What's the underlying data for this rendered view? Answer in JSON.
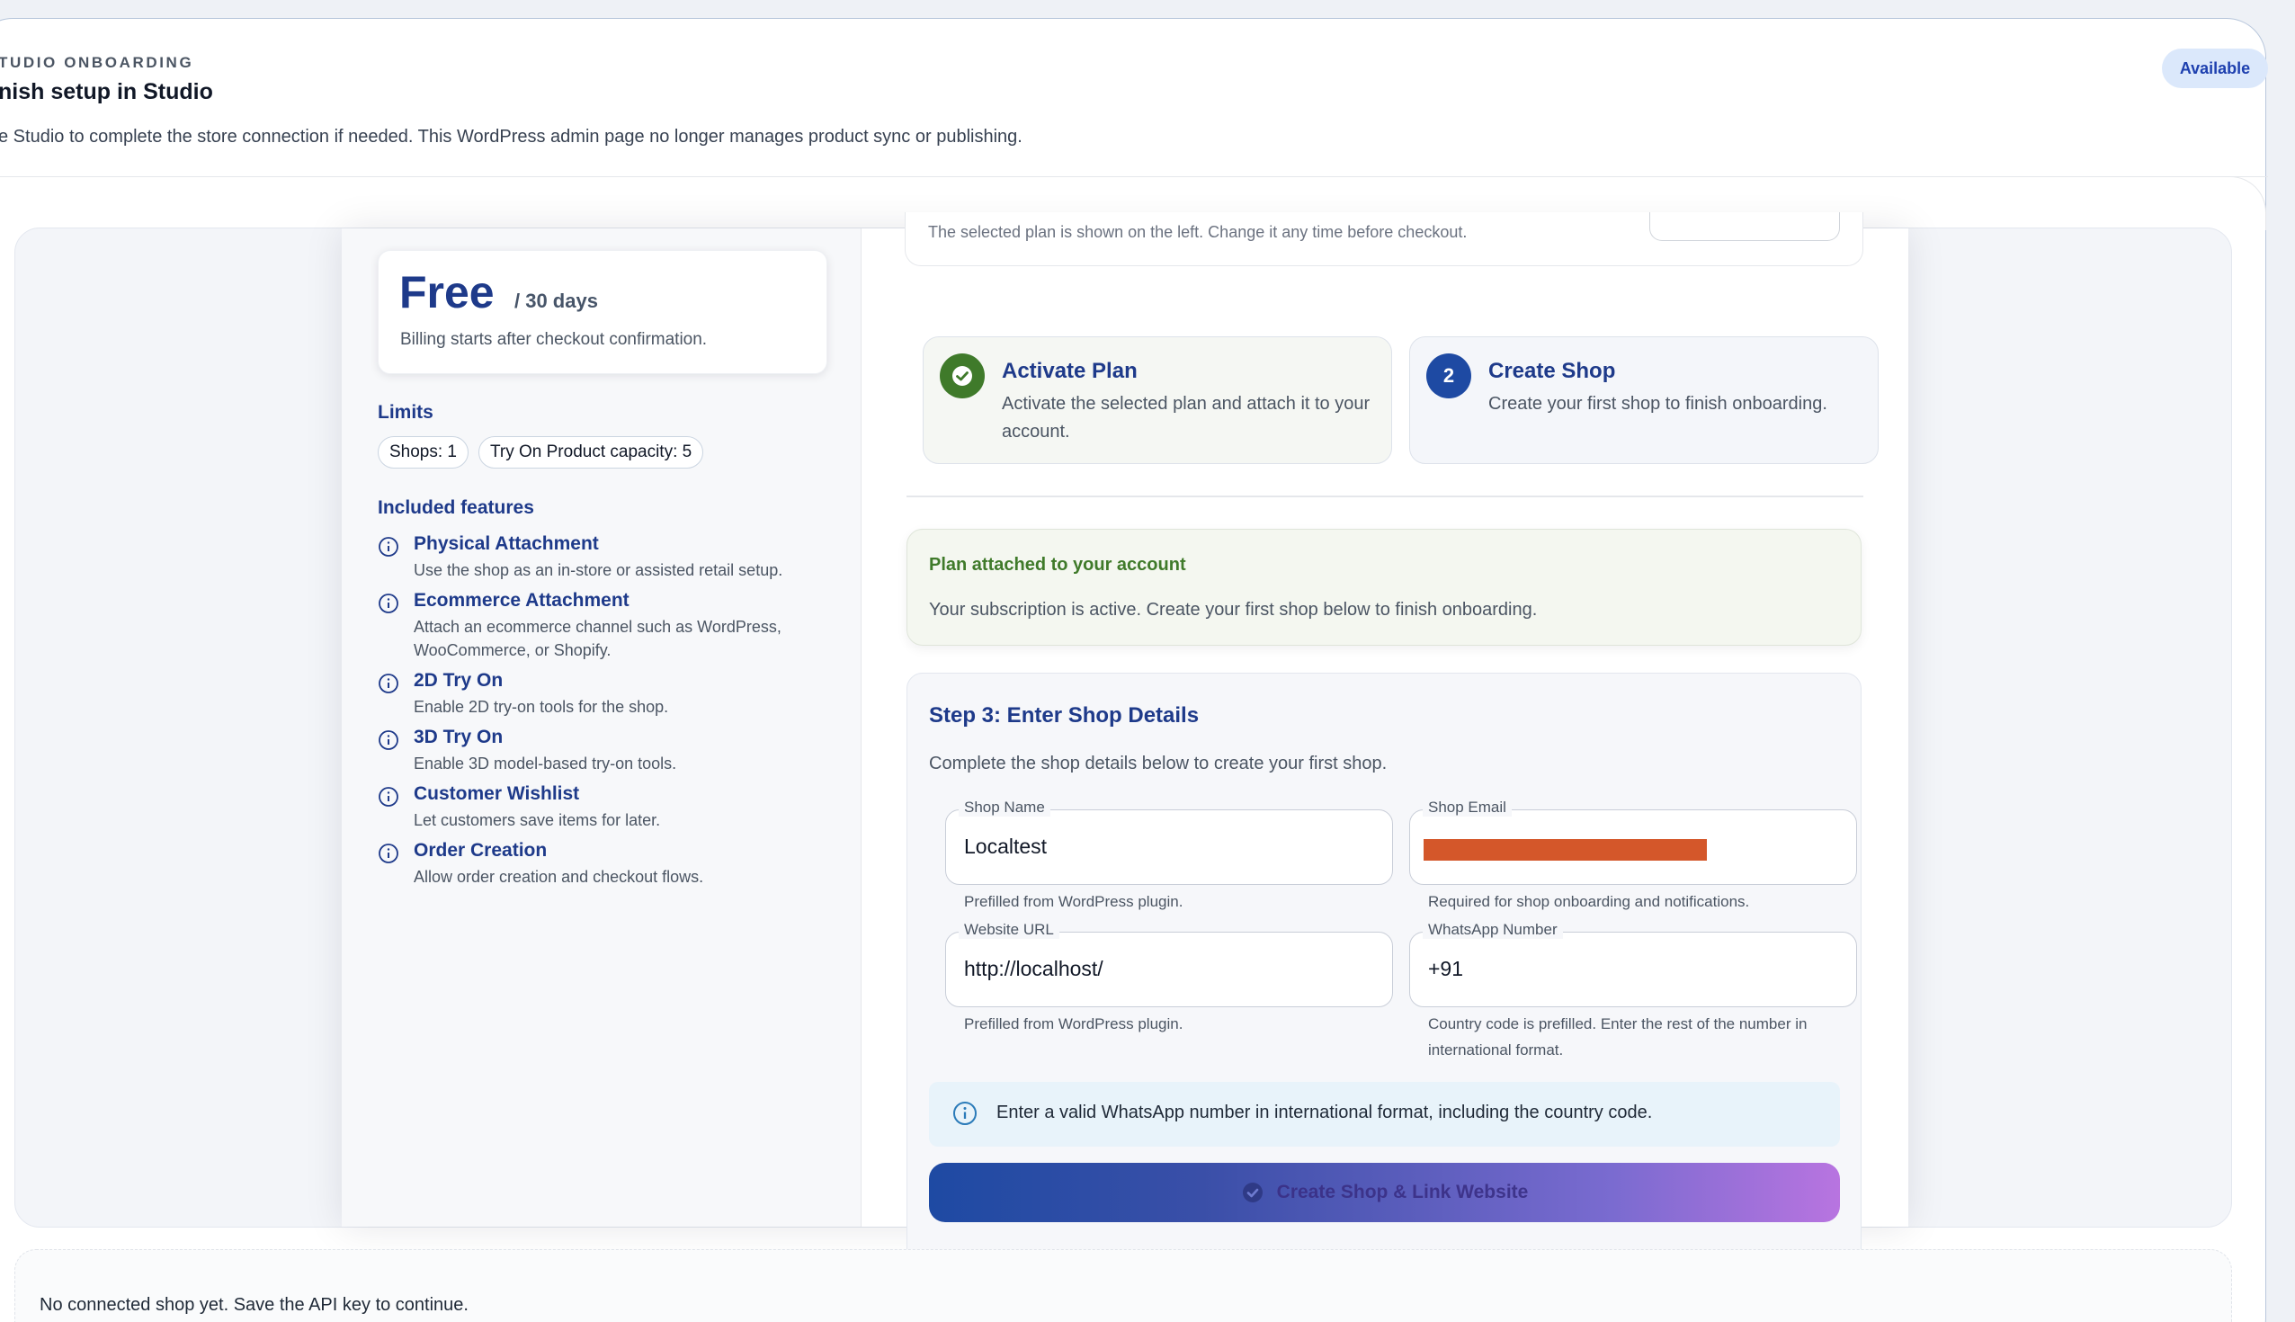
{
  "header": {
    "eyebrow": "TUDIO ONBOARDING",
    "title": "nish setup in Studio",
    "description": "e Studio to complete the store connection if needed. This WordPress admin page no longer manages product sync or publishing.",
    "badge": "Available"
  },
  "plan": {
    "price": "Free",
    "period": "/ 30 days",
    "billing_note": "Billing starts after checkout confirmation.",
    "limits_title": "Limits",
    "limits": [
      "Shops: 1",
      "Try On Product capacity: 5"
    ],
    "features_title": "Included features",
    "features": [
      {
        "name": "Physical Attachment",
        "desc": "Use the shop as an in-store or assisted retail setup."
      },
      {
        "name": "Ecommerce Attachment",
        "desc": "Attach an ecommerce channel such as WordPress, WooCommerce, or Shopify."
      },
      {
        "name": "2D Try On",
        "desc": "Enable 2D try-on tools for the shop."
      },
      {
        "name": "3D Try On",
        "desc": "Enable 3D model-based try-on tools."
      },
      {
        "name": "Customer Wishlist",
        "desc": "Let customers save items for later."
      },
      {
        "name": "Order Creation",
        "desc": "Allow order creation and checkout flows."
      }
    ]
  },
  "top_stub_text": "The selected plan is shown on the left. Change it any time before checkout.",
  "steps": [
    {
      "title": "Activate Plan",
      "desc": "Activate the selected plan and attach it to your account.",
      "state": "done"
    },
    {
      "number": "2",
      "title": "Create Shop",
      "desc": "Create your first shop to finish onboarding.",
      "state": "active"
    }
  ],
  "alert": {
    "title": "Plan attached to your account",
    "text": "Your subscription is active. Create your first shop below to finish onboarding."
  },
  "form": {
    "title": "Step 3: Enter Shop Details",
    "subtitle": "Complete the shop details below to create your first shop.",
    "shop_name": {
      "label": "Shop Name",
      "value": "Localtest",
      "helper": "Prefilled from WordPress plugin."
    },
    "shop_email": {
      "label": "Shop Email",
      "value": "",
      "helper": "Required for shop onboarding and notifications."
    },
    "website_url": {
      "label": "Website URL",
      "value": "http://localhost/",
      "helper": "Prefilled from WordPress plugin."
    },
    "whatsapp": {
      "label": "WhatsApp Number",
      "value": "+91",
      "helper": "Country code is prefilled. Enter the rest of the number in international format."
    },
    "info": "Enter a valid WhatsApp number in international format, including the country code.",
    "submit_label": "Create Shop & Link Website"
  },
  "bottom_status": "No connected shop yet. Save the API key to continue.",
  "colors": {
    "brand_navy": "#1e3a8a",
    "success_green": "#3f7a2a",
    "badge_bg": "#dbe8fb",
    "redaction": "#d4572a"
  }
}
